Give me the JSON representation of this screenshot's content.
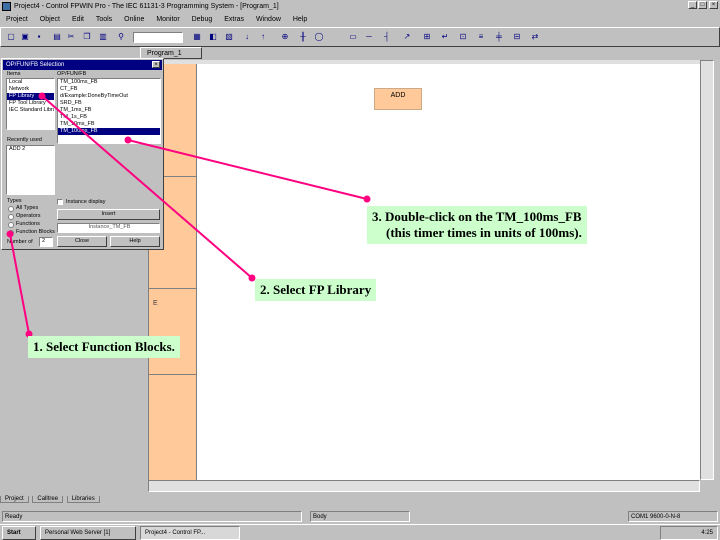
{
  "window": {
    "title": "Project4 - Control FPWIN Pro - The IEC 61131-3 Programming System - [Program_1]",
    "minimize_glyph": "_",
    "maximize_glyph": "□",
    "close_glyph": "×"
  },
  "menu": [
    "Project",
    "Object",
    "Edit",
    "Tools",
    "Online",
    "Monitor",
    "Debug",
    "Extras",
    "Window",
    "Help"
  ],
  "toolbar": {
    "icons": [
      "new-icon",
      "open-icon",
      "save-icon",
      "print-icon",
      "cut-icon",
      "copy-icon",
      "paste-icon",
      "find-icon",
      "compile-icon",
      "online-icon",
      "monitor-icon",
      "download-icon",
      "upload-icon",
      "zoom-icon",
      "contact-icon",
      "coil-icon",
      "box-icon",
      "line-icon"
    ]
  },
  "document_tab": "Program_1",
  "dialog": {
    "title": "OP/FUN/FB Selection",
    "close_glyph": "×",
    "items_label": "Items",
    "items": [
      "Local",
      "Network",
      "FP Library",
      "FP Tool Library",
      "IEC Standard Library"
    ],
    "items_selected": 2,
    "list_header": "OP/FUN/FB",
    "list_items": [
      "TM_100ms_FB",
      "CT_FB",
      "d/Example:DoneByTimeOut",
      "SRD_FB",
      "TM_1ms_FB",
      "TM_1s_FB",
      "TM_10ms_FB",
      "TM_100ms_FB"
    ],
    "list_selected": 7,
    "recently_used_label": "Recently used",
    "recently_used_value": "ADD 2",
    "types_label": "Types",
    "types": [
      "All Types",
      "Operators",
      "Functions",
      "Function Blocks"
    ],
    "types_selected": 3,
    "instance_label": "Instance display",
    "insert_label": "Insert",
    "instance_value": "Instance_TM_FB",
    "inputs_label": "Number of",
    "inputs_value": "2",
    "close_label": "Close",
    "help_label": "Help"
  },
  "editor": {
    "rung_label": "E",
    "block_label": "ADD"
  },
  "project_tabs": [
    "Project",
    "Calltree",
    "Libraries"
  ],
  "status": {
    "ready": "Ready",
    "body": "Body",
    "plc": "COM1 9600-0-N-8"
  },
  "taskbar": {
    "start": "Start",
    "tasks": [
      "Personal Web Server [1]",
      "Project4 - Control FP..."
    ],
    "time": "4:25"
  },
  "callouts": {
    "step1": "1. Select Function Blocks.",
    "step2": "2. Select FP Library",
    "step3_line1": "3. Double-click on the TM_100ms_FB",
    "step3_line2": "(this timer times in units of 100ms)."
  },
  "colors": {
    "callout_bg": "#ccffcc",
    "arrow": "#ff0080",
    "rung_col": "#ffc999",
    "title_active": "#000080"
  }
}
